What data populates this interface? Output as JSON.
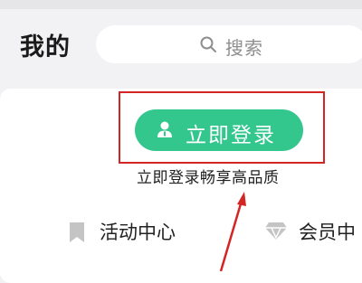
{
  "header": {
    "title": "我的",
    "search": {
      "placeholder": "搜索",
      "icon": "search-icon"
    }
  },
  "login": {
    "button_label": "立即登录",
    "button_icon": "person-icon",
    "subtitle": "立即登录畅享高品质"
  },
  "menu": {
    "items": [
      {
        "label": "活动中心",
        "icon": "bookmark-icon"
      },
      {
        "label": "会员中",
        "icon": "diamond-icon"
      }
    ]
  },
  "colors": {
    "accent_green": "#33c78e",
    "highlight_red": "#d42525",
    "background": "#f2f2f4"
  }
}
